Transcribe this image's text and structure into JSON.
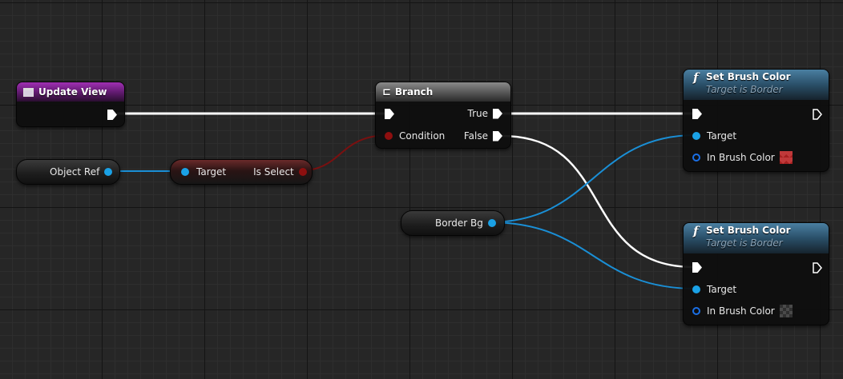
{
  "nodes": {
    "update_view": {
      "title": "Update View",
      "icon": "event-icon"
    },
    "object_ref": {
      "label": "Object Ref"
    },
    "is_select": {
      "input_label": "Target",
      "output_label": "Is Select"
    },
    "branch": {
      "title": "Branch",
      "icon": "branch-icon",
      "true_label": "True",
      "condition_label": "Condition",
      "false_label": "False"
    },
    "set_brush_color_1": {
      "title": "Set Brush Color",
      "subtitle": "Target is Border",
      "target_label": "Target",
      "color_label": "In Brush Color",
      "color_value": "#c0393a"
    },
    "border_bg": {
      "label": "Border Bg"
    },
    "set_brush_color_2": {
      "title": "Set Brush Color",
      "subtitle": "Target is Border",
      "target_label": "Target",
      "color_label": "In Brush Color",
      "color_value": "#2f2f2f"
    }
  },
  "colors": {
    "exec_wire": "#ffffff",
    "object_wire": "#1a8fd6",
    "bool_wire": "#7a1010",
    "event_header": "#a02fb3",
    "function_header": "#4a7fa1",
    "branch_header": "#8a8a8a"
  }
}
